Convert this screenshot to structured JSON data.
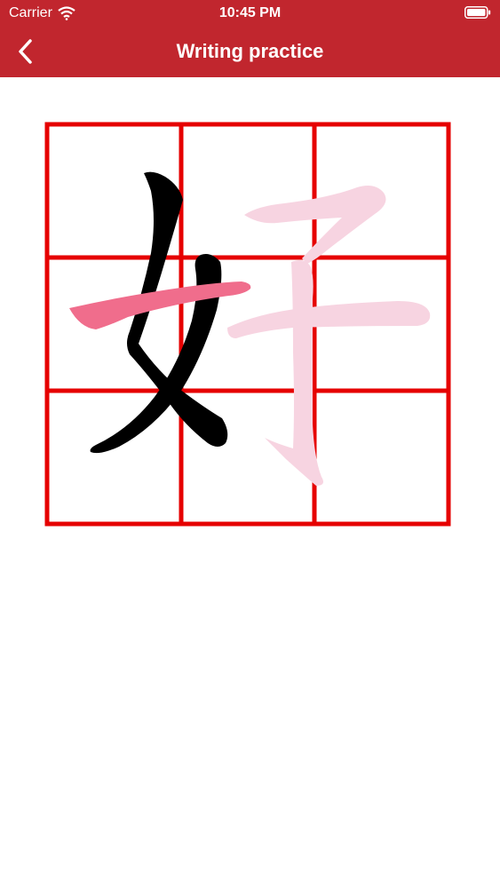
{
  "status_bar": {
    "carrier": "Carrier",
    "time": "10:45 PM",
    "wifi_icon": "wifi-icon",
    "battery_icon": "battery-icon"
  },
  "nav": {
    "back_icon": "chevron-left-icon",
    "title": "Writing practice"
  },
  "practice": {
    "character": "好",
    "grid_color": "#e60000",
    "completed_stroke_color": "#000000",
    "active_stroke_color": "#f06d8c",
    "pending_stroke_color": "#f7d4e1",
    "strokes_total": 6,
    "strokes_completed": 2,
    "active_stroke_index": 3
  },
  "theme": {
    "header_color": "#c1262e",
    "background": "#ffffff"
  }
}
